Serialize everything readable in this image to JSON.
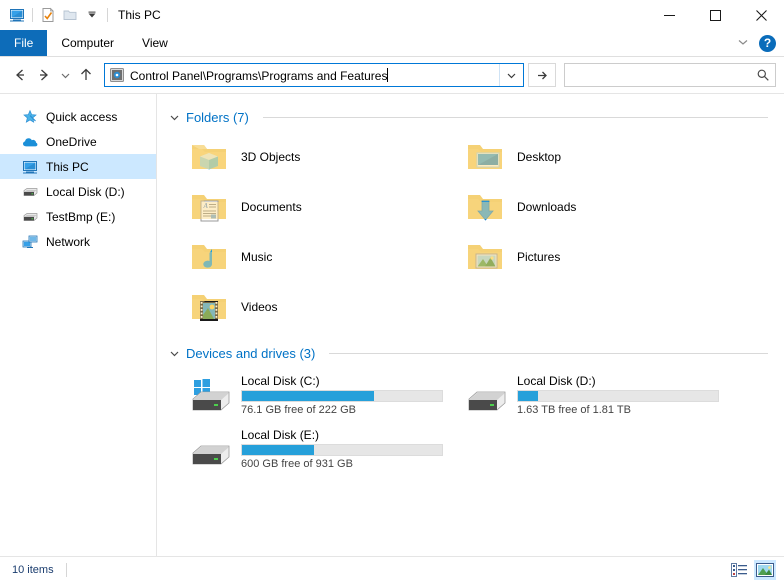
{
  "window": {
    "title": "This PC",
    "quick_access_toolbar": [
      {
        "name": "this-pc-icon",
        "label": "This PC"
      },
      {
        "name": "properties-icon",
        "label": "Properties"
      },
      {
        "name": "new-folder-icon",
        "label": "New folder"
      },
      {
        "name": "customize-dropdown-icon",
        "label": "Customize Quick Access Toolbar"
      }
    ],
    "controls": {
      "minimize": "—",
      "maximize": "□",
      "close": "✕"
    }
  },
  "ribbon": {
    "tabs": [
      {
        "label": "File",
        "active": true
      },
      {
        "label": "Computer",
        "active": false
      },
      {
        "label": "View",
        "active": false
      }
    ],
    "collapse_label": "⌄",
    "help_label": "?"
  },
  "navbar": {
    "back_label": "←",
    "forward_label": "→",
    "recent_label": "⌄",
    "up_label": "↑",
    "address_value": "Control Panel\\Programs\\Programs and Features",
    "address_dropdown_label": "⌄",
    "go_label": "→",
    "search_value": "",
    "search_placeholder": ""
  },
  "sidebar": {
    "items": [
      {
        "label": "Quick access",
        "icon": "star-pin-icon",
        "selected": false
      },
      {
        "label": "OneDrive",
        "icon": "cloud-icon",
        "selected": false
      },
      {
        "label": "This PC",
        "icon": "monitor-icon",
        "selected": true
      },
      {
        "label": "Local Disk (D:)",
        "icon": "drive-icon",
        "selected": false
      },
      {
        "label": "TestBmp (E:)",
        "icon": "drive-icon",
        "selected": false
      },
      {
        "label": "Network",
        "icon": "network-icon",
        "selected": false
      }
    ]
  },
  "content": {
    "groups": [
      {
        "title": "Folders (7)",
        "expanded": true,
        "items": [
          {
            "label": "3D Objects",
            "icon": "folder-3d-objects-icon"
          },
          {
            "label": "Desktop",
            "icon": "folder-desktop-icon"
          },
          {
            "label": "Documents",
            "icon": "folder-documents-icon"
          },
          {
            "label": "Downloads",
            "icon": "folder-downloads-icon"
          },
          {
            "label": "Music",
            "icon": "folder-music-icon"
          },
          {
            "label": "Pictures",
            "icon": "folder-pictures-icon"
          },
          {
            "label": "Videos",
            "icon": "folder-videos-icon"
          }
        ]
      },
      {
        "title": "Devices and drives (3)",
        "expanded": true,
        "drives": [
          {
            "label": "Local Disk (C:)",
            "icon": "windows-drive-icon",
            "free_text": "76.1 GB free of 222 GB",
            "used_percent": 66
          },
          {
            "label": "Local Disk (D:)",
            "icon": "drive-icon",
            "free_text": "1.63 TB free of 1.81 TB",
            "used_percent": 10
          },
          {
            "label": "Local Disk (E:)",
            "icon": "drive-icon",
            "free_text": "600 GB free of 931 GB",
            "used_percent": 36
          }
        ]
      }
    ]
  },
  "statusbar": {
    "item_count": "10 items",
    "view_details_label": "Details view",
    "view_large_icons_label": "Large icons view"
  },
  "colors": {
    "accent_blue": "#0d6cb9",
    "link_blue": "#0072c6",
    "progress_blue": "#26a0da",
    "selection_blue": "#cce8ff",
    "folder_yellow": "#fcd577"
  }
}
